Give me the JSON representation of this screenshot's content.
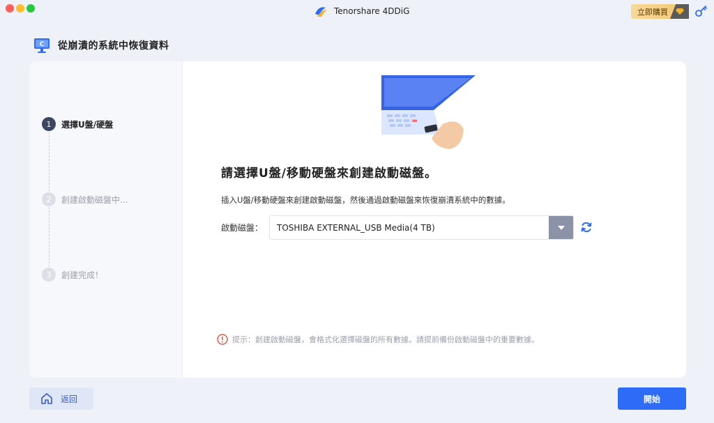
{
  "app": {
    "title": "Tenorshare 4DDiG",
    "buy_label": "立即購買"
  },
  "page": {
    "title": "從崩潰的系統中恢復資料"
  },
  "steps": [
    {
      "number": "1",
      "label": "選擇U盤/硬盤",
      "state": "active"
    },
    {
      "number": "2",
      "label": "創建啟動磁盤中...",
      "state": "inactive"
    },
    {
      "number": "3",
      "label": "創建完成！",
      "state": "inactive"
    }
  ],
  "main": {
    "title": "請選擇U盤/移動硬盤來創建啟動磁盤。",
    "description": "插入U盤/移動硬盤來創建啟動磁盤，然後通過啟動磁盤來恢復崩潰系統中的數據。",
    "drive_label": "啟動磁盤：",
    "drive_value": "TOSHIBA EXTERNAL_USB Media(4 TB)",
    "tip": "提示：創建啟動磁盤，會格式化選擇磁盤的所有數據。請提前備份啟動磁盤中的重要數據。"
  },
  "footer": {
    "back_label": "返回",
    "start_label": "開始"
  },
  "icons": {
    "window_close": "close-icon",
    "window_minimize": "minimize-icon",
    "window_zoom": "zoom-icon",
    "app_logo": "4ddig-logo-icon",
    "buy_badge": "diamond-icon",
    "key": "key-icon",
    "page": "computer-icon",
    "dropdown": "chevron-down-icon",
    "refresh": "refresh-icon",
    "tip": "warning-icon",
    "home": "home-icon"
  },
  "colors": {
    "accent": "#2e6bf6",
    "active_step": "#3c4660",
    "warning": "#e05a45"
  }
}
